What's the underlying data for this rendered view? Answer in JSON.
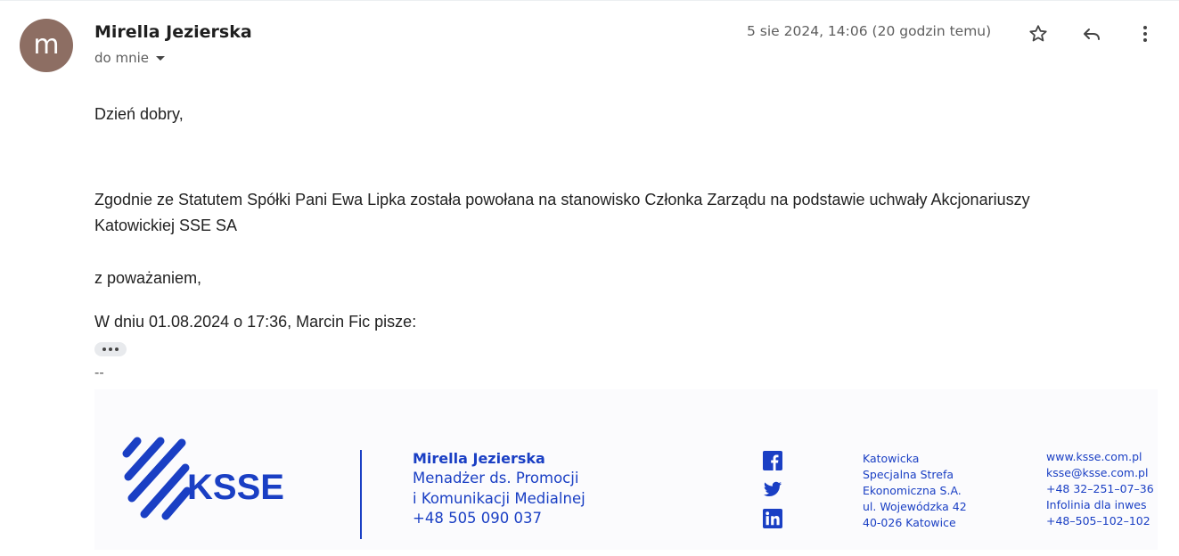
{
  "header": {
    "avatar_letter": "m",
    "avatar_color": "#8d6e63",
    "sender_name": "Mirella Jezierska",
    "recipient": "do mnie",
    "timestamp": "5 sie 2024, 14:06 (20 godzin temu)",
    "icons": [
      "star-icon",
      "reply-icon",
      "more-vert-icon"
    ]
  },
  "body": {
    "greeting": "Dzień dobry,",
    "paragraph_line1": "Zgodnie ze Statutem Spółki Pani Ewa Lipka została powołana na stanowisko Członka Zarządu na podstawie uchwały Akcjonariuszy",
    "paragraph_line2": "Katowickiej SSE SA",
    "closing": "z poważaniem,",
    "quote_header": "W dniu 01.08.2024 o 17:36, Marcin Fic pisze:",
    "signature_separator": "--"
  },
  "signature": {
    "brand_color": "#1a3fc4",
    "logo_text": "KSSE",
    "name": "Mirella Jezierska",
    "role_line1": "Menadżer ds. Promocji",
    "role_line2": "i Komunikacji Medialnej",
    "phone": "+48 505 090 037",
    "social_icons": [
      "facebook-icon",
      "twitter-icon",
      "linkedin-icon"
    ],
    "address": [
      "Katowicka",
      "Specjalna Strefa",
      "Ekonomiczna S.A.",
      "ul. Wojewódzka 42",
      "40-026 Katowice"
    ],
    "contact": [
      "www.ksse.com.pl",
      "ksse@ksse.com.pl",
      "+48 32–251–07–36",
      "Infolinia dla inwes",
      "+48–505–102–102"
    ]
  }
}
